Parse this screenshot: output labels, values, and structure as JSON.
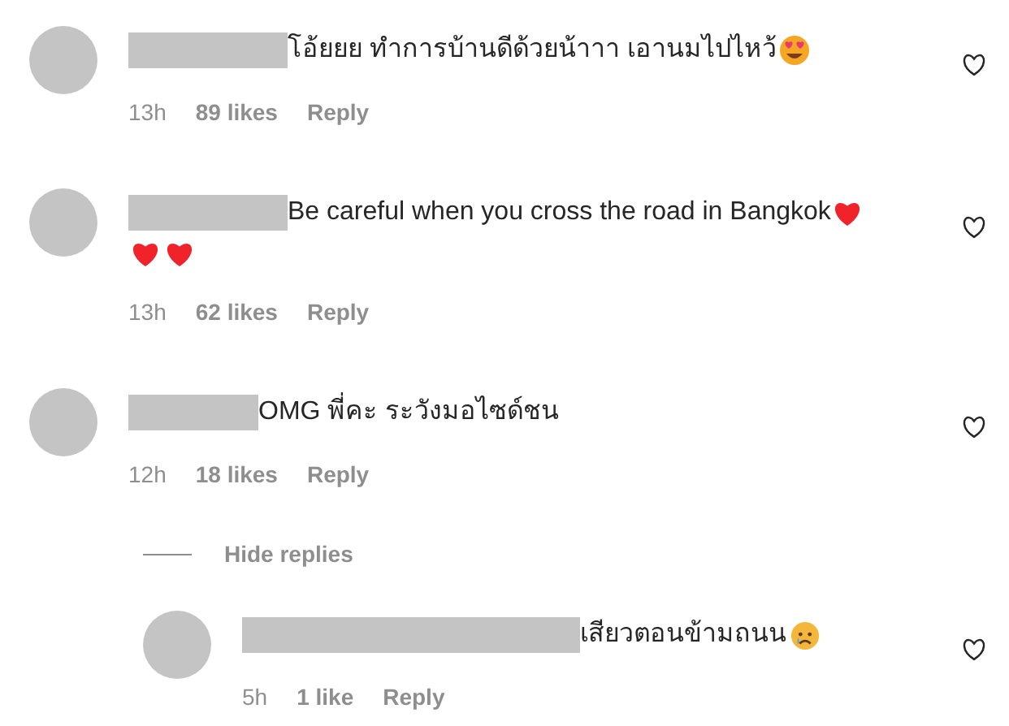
{
  "comments": [
    {
      "body": [
        {
          "kind": "text",
          "text": "โอ้ยยย ทำการบ้านดีด้วยน้าาา เอานมไปไหว้"
        },
        {
          "kind": "heart-eyes-emoji"
        }
      ],
      "time": "13h",
      "likes": "89 likes",
      "reply": "Reply",
      "liked": false
    },
    {
      "body": [
        {
          "kind": "text",
          "text": "Be careful when you cross the road in Bangkok"
        },
        {
          "kind": "red-heart-emoji"
        },
        {
          "kind": "break"
        },
        {
          "kind": "red-heart-emoji"
        },
        {
          "kind": "red-heart-emoji"
        }
      ],
      "time": "13h",
      "likes": "62 likes",
      "reply": "Reply",
      "liked": false
    },
    {
      "body": [
        {
          "kind": "text",
          "text": "OMG พี่คะ ระวังมอไซด์ชน"
        }
      ],
      "time": "12h",
      "likes": "18 likes",
      "reply": "Reply",
      "liked": false,
      "hide_replies": "Hide replies",
      "replies": [
        {
          "body": [
            {
              "kind": "text",
              "text": "เสียวตอนข้ามถนน"
            },
            {
              "kind": "sad-face-emoji"
            }
          ],
          "time": "5h",
          "likes": "1 like",
          "reply": "Reply",
          "liked": false
        }
      ]
    }
  ]
}
